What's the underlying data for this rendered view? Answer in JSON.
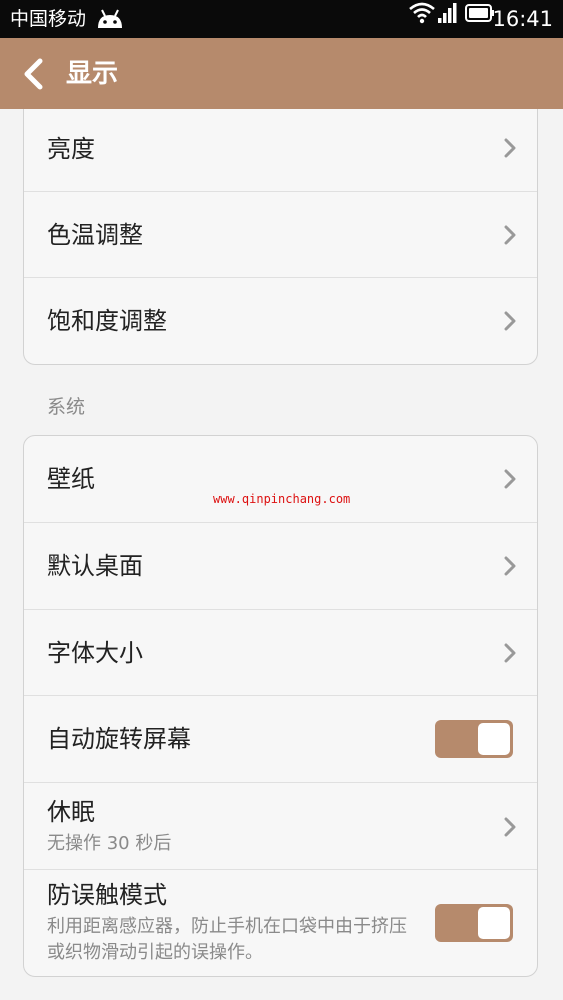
{
  "status_bar": {
    "carrier": "中国移动",
    "time": "16:41"
  },
  "header": {
    "title": "显示"
  },
  "top_group": {
    "items": [
      {
        "label": "亮度"
      },
      {
        "label": "色温调整"
      },
      {
        "label": "饱和度调整"
      }
    ]
  },
  "system": {
    "header": "系统",
    "items": [
      {
        "label": "壁纸"
      },
      {
        "label": "默认桌面"
      },
      {
        "label": "字体大小"
      },
      {
        "label": "自动旋转屏幕",
        "toggle_on": true
      },
      {
        "label": "休眠",
        "sub": "无操作 30 秒后"
      },
      {
        "label": "防误触模式",
        "sub": "利用距离感应器，防止手机在口袋中由于挤压或织物滑动引起的误操作。",
        "toggle_on": true
      }
    ]
  },
  "watermark": "www.qinpinchang.com",
  "colors": {
    "accent": "#b68a6c",
    "status_bar_bg": "#0a0a0a",
    "background": "#f3f3f3"
  }
}
